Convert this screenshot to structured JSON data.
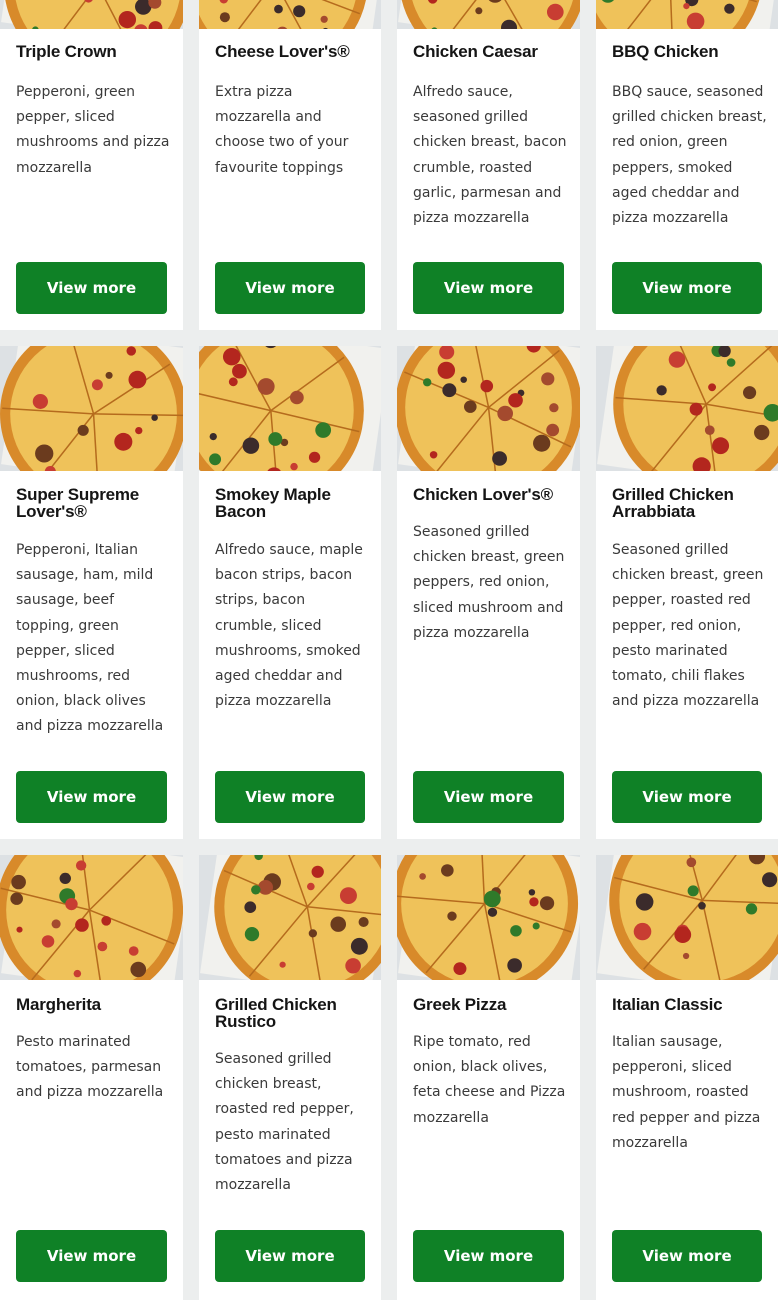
{
  "button_label": "View more",
  "colors": {
    "button": "#0f8126",
    "card": "#ffffff",
    "background": "#eceeee"
  },
  "pizzas": [
    {
      "name": "Triple Crown",
      "description": "Pepperoni, green pepper, sliced mushrooms and pizza mozzarella",
      "icon": "pizza-image"
    },
    {
      "name": "Cheese Lover's®",
      "description": "Extra pizza mozzarella and choose two of your favourite toppings",
      "icon": "pizza-image"
    },
    {
      "name": "Chicken Caesar",
      "description": "Alfredo sauce, seasoned grilled chicken breast, bacon crumble, roasted garlic, parmesan and pizza mozzarella",
      "icon": "pizza-image"
    },
    {
      "name": "BBQ Chicken",
      "description": "BBQ sauce, seasoned grilled chicken breast, red onion, green peppers, smoked aged cheddar and pizza mozzarella",
      "icon": "pizza-image"
    },
    {
      "name": "Super Supreme Lover's®",
      "description": "Pepperoni, Italian sausage, ham, mild sausage, beef topping, green pepper, sliced mushrooms, red onion, black olives and pizza mozzarella",
      "icon": "pizza-image"
    },
    {
      "name": "Smokey Maple Bacon",
      "description": "Alfredo sauce, maple bacon strips, bacon strips, bacon crumble, sliced mushrooms, smoked aged cheddar and pizza mozzarella",
      "icon": "pizza-image"
    },
    {
      "name": "Chicken Lover's®",
      "description": "Seasoned grilled chicken breast, green peppers, red onion, sliced mushroom and pizza mozzarella",
      "icon": "pizza-image"
    },
    {
      "name": "Grilled Chicken Arrabbiata",
      "description": "Seasoned grilled chicken breast, green pepper, roasted red pepper, red onion, pesto marinated tomato, chili flakes and pizza mozzarella",
      "icon": "pizza-image"
    },
    {
      "name": "Margherita",
      "description": "Pesto marinated tomatoes, parmesan and pizza mozzarella",
      "icon": "pizza-image"
    },
    {
      "name": "Grilled Chicken Rustico",
      "description": "Seasoned grilled chicken breast, roasted red pepper, pesto marinated tomatoes and pizza mozzarella",
      "icon": "pizza-image"
    },
    {
      "name": "Greek Pizza",
      "description": "Ripe tomato, red onion, black olives, feta cheese and Pizza mozzarella",
      "icon": "pizza-image"
    },
    {
      "name": "Italian Classic",
      "description": "Italian sausage, pepperoni, sliced mushroom, roasted red pepper and pizza mozzarella",
      "icon": "pizza-image"
    }
  ]
}
